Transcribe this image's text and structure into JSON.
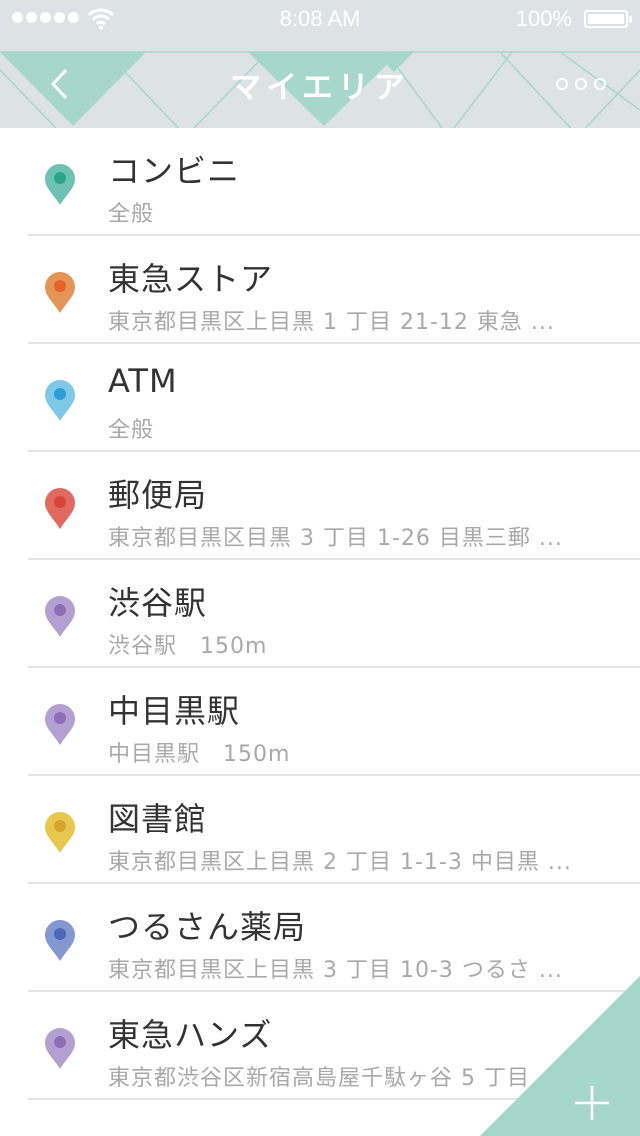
{
  "status_bar": {
    "time": "8:08 AM",
    "battery": "100%"
  },
  "nav": {
    "title": "マイエリア",
    "back_icon": "chevron-left-icon",
    "more_icon": "more-dots-icon"
  },
  "colors": {
    "nav_bg": "#dde3e4",
    "accent_teal": "#a7d6cc",
    "text_primary": "#333333",
    "text_secondary": "#a9a9a9"
  },
  "places": [
    {
      "name": "コンビニ",
      "sub": "全般",
      "color": "#6ec2b4",
      "dot": "#2aa58a"
    },
    {
      "name": "東急ストア",
      "sub": "東京都目黒区上目黒 1 丁目 21-12 東急 ...",
      "color": "#e39457",
      "dot": "#e5622a"
    },
    {
      "name": "ATM",
      "sub": "全般",
      "color": "#7ec8e8",
      "dot": "#2a9ed6"
    },
    {
      "name": "郵便局",
      "sub": "東京都目黒区目黒 3 丁目 1-26 目黒三郵 ...",
      "color": "#e06a62",
      "dot": "#d8443c"
    },
    {
      "name": "渋谷駅",
      "sub": "渋谷駅　150m",
      "color": "#b4a0d0",
      "dot": "#8c6eb8"
    },
    {
      "name": "中目黒駅",
      "sub": "中目黒駅　150m",
      "color": "#b4a0d0",
      "dot": "#8c6eb8"
    },
    {
      "name": "図書館",
      "sub": "東京都目黒区上目黒 2 丁目 1-1-3 中目黒 ...",
      "color": "#e6c84e",
      "dot": "#d6a52a"
    },
    {
      "name": "つるさん薬局",
      "sub": "東京都目黒区上目黒 3 丁目 10-3 つるさ ...",
      "color": "#8497d0",
      "dot": "#4d68b8"
    },
    {
      "name": "東急ハンズ",
      "sub": "東京都渋谷区新宿高島屋千駄ヶ谷 5 丁目 ...",
      "color": "#b4a0d0",
      "dot": "#8c6eb8"
    }
  ],
  "add_button": {
    "icon": "plus-icon"
  }
}
